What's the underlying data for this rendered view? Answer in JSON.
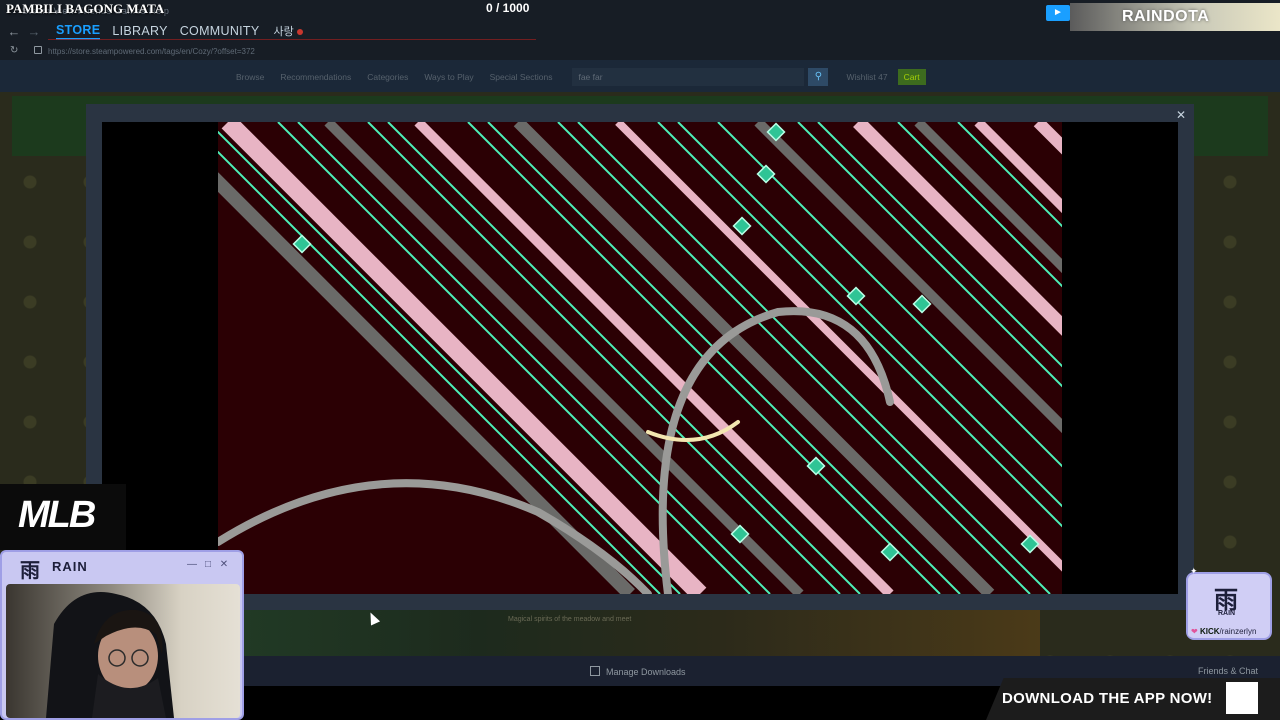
{
  "stream_overlay": {
    "title": "PAMBILI BAGONG MATA",
    "counter": "0   / 1000",
    "channel_banner": "RAINDOTA",
    "app_banner": "DOWNLOAD THE APP NOW!",
    "mlb_logo": "MLB",
    "webcam_title": "RAIN",
    "webcam_logo": "雨",
    "badge_logo": "雨",
    "badge_name": "RAIN",
    "kick_label": "KICK",
    "kick_handle": "/rainzerlyn"
  },
  "steam": {
    "menu_strip": "Steam   View   Friends   Games   Help",
    "tabs": [
      "STORE",
      "LIBRARY",
      "COMMUNITY"
    ],
    "user": "사랑",
    "url": "https://store.steampowered.com/tags/en/Cozy/?offset=372",
    "store_nav": [
      "Browse",
      "Recommendations",
      "Categories",
      "Ways to Play",
      "Special Sections"
    ],
    "search_value": "fae far",
    "wishlist": "Wishlist 47",
    "cart": "Cart",
    "strip_text": "Magical spirits of the meadow and meet",
    "manage_downloads": "Manage Downloads",
    "friends_chat": "Friends & Chat"
  },
  "icons": {
    "back": "back-arrow-icon",
    "forward": "forward-arrow-icon",
    "reload": "reload-icon",
    "lock": "lock-icon",
    "search": "search-icon",
    "close": "close-icon",
    "cursor": "mouse-cursor-icon",
    "qr": "qr-code-icon"
  },
  "colors": {
    "steam_blue": "#1a9fff",
    "game_bg": "#2b0004",
    "stripe_teal": "#4df0b8",
    "stripe_pink": "#e8b4c4",
    "stripe_gray": "#6a6a68",
    "overlay_lavender": "#c9c8f2"
  }
}
